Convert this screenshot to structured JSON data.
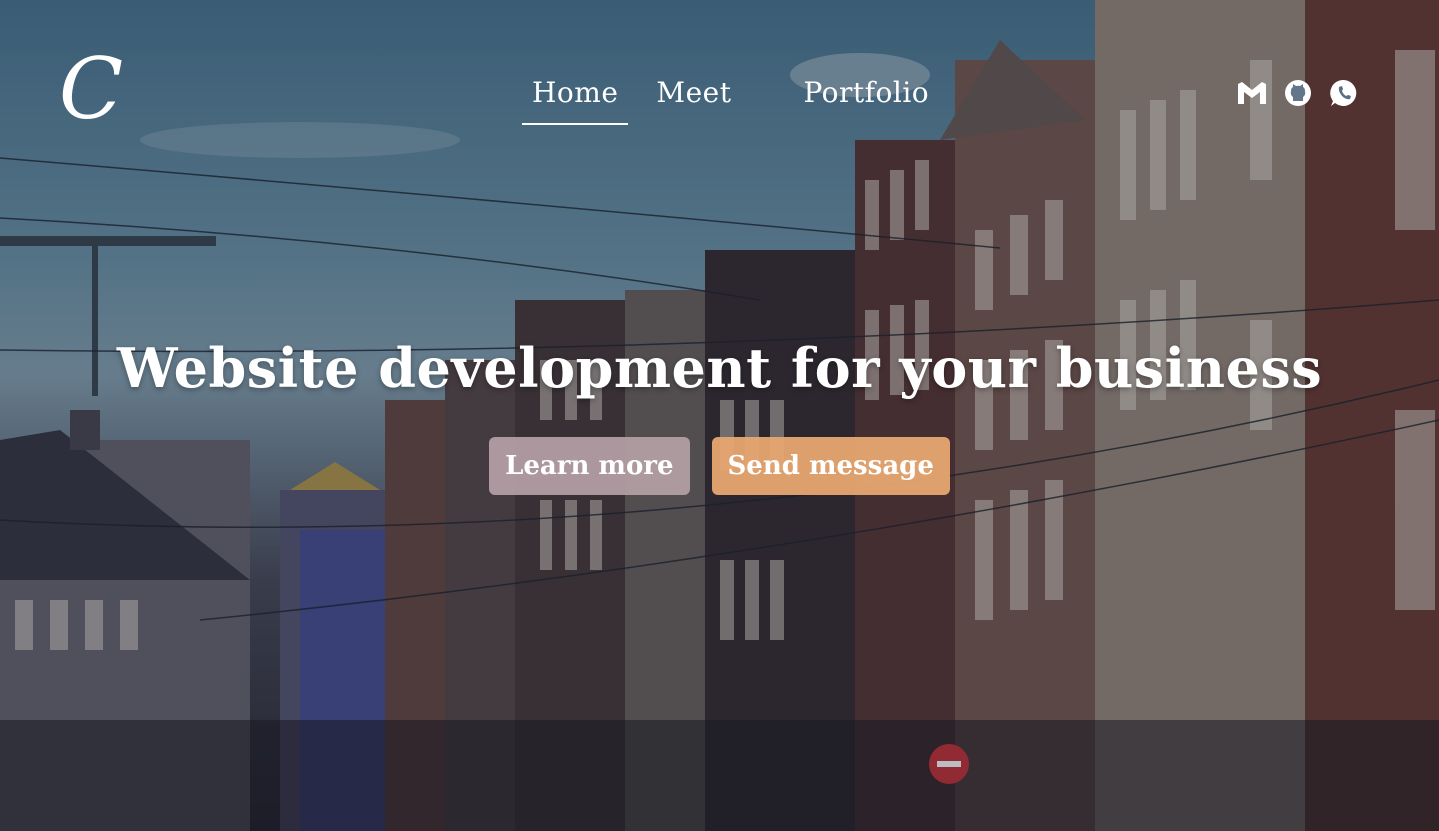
{
  "brand": {
    "logo_glyph": "C"
  },
  "nav": {
    "items": [
      {
        "label": "Home",
        "active": true
      },
      {
        "label": "Meet",
        "active": false
      },
      {
        "label": "Portfolio",
        "active": false
      }
    ]
  },
  "socials": [
    {
      "icon": "gmail-icon"
    },
    {
      "icon": "github-icon"
    },
    {
      "icon": "whatsapp-icon"
    }
  ],
  "hero": {
    "headline": "Website development for your business",
    "primary_button": "Learn more",
    "secondary_button": "Send message"
  },
  "colors": {
    "learn_button": "#b5a1a6",
    "send_button": "#e7a770",
    "text": "#ffffff"
  }
}
